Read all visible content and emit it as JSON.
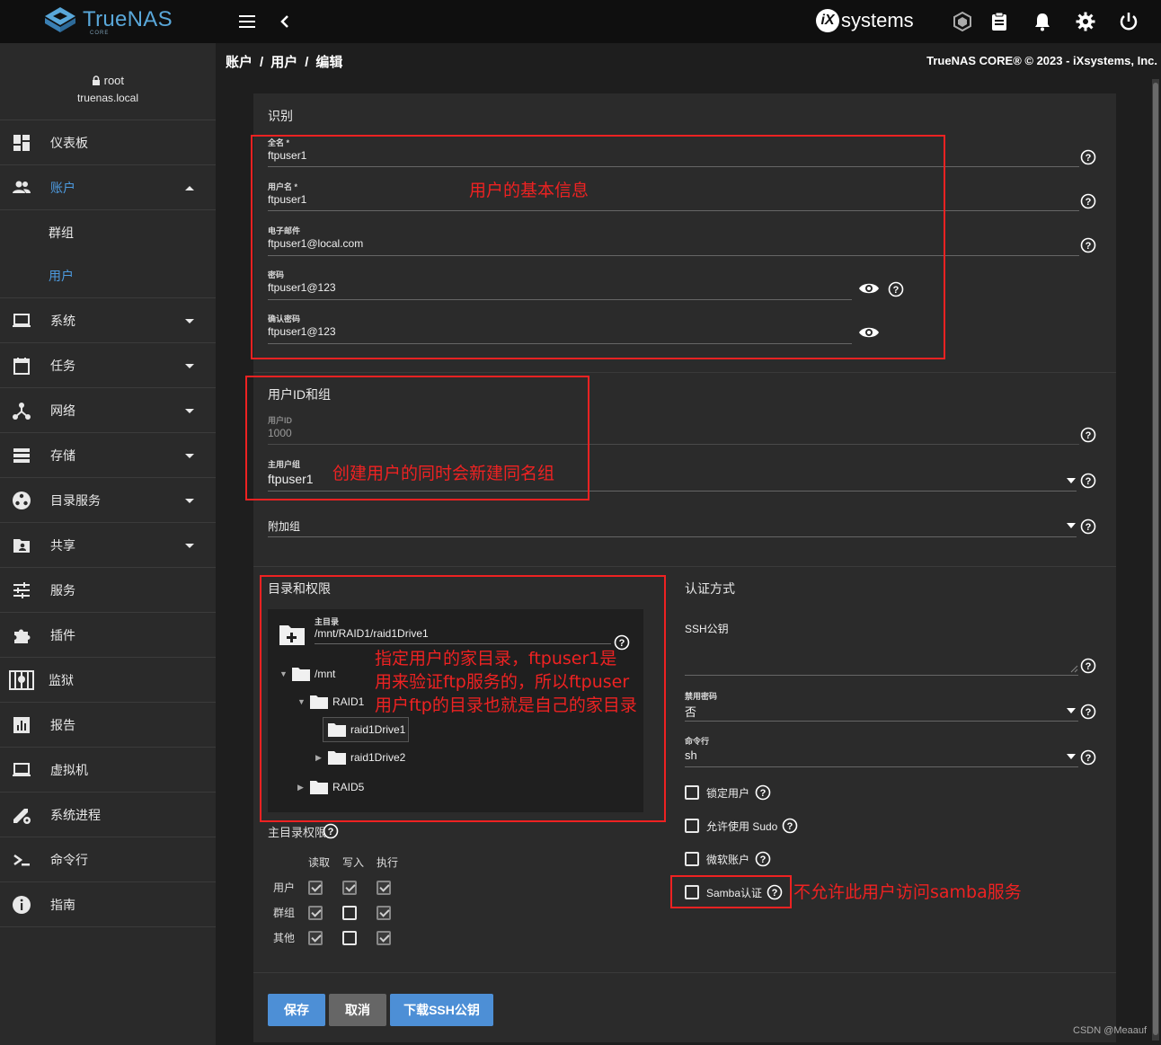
{
  "app": {
    "logo_text": "TrueNAS",
    "logo_sub": "CORE",
    "brand": "systems",
    "brand_ix": "iX"
  },
  "sidebar": {
    "user_name": "root",
    "host": "truenas.local",
    "items": [
      {
        "label": "仪表板",
        "icon": "dashboard-icon"
      },
      {
        "label": "账户",
        "icon": "people-icon",
        "expanded": true
      },
      {
        "label": "群组",
        "icon": ""
      },
      {
        "label": "用户",
        "icon": "",
        "active": true
      },
      {
        "label": "系统",
        "icon": "laptop-icon"
      },
      {
        "label": "任务",
        "icon": "calendar-icon"
      },
      {
        "label": "网络",
        "icon": "network-icon"
      },
      {
        "label": "存储",
        "icon": "storage-icon"
      },
      {
        "label": "目录服务",
        "icon": "directory-icon"
      },
      {
        "label": "共享",
        "icon": "share-folder-icon"
      },
      {
        "label": "服务",
        "icon": "tune-icon"
      },
      {
        "label": "插件",
        "icon": "puzzle-icon"
      },
      {
        "label": "监狱",
        "icon": "jail-icon"
      },
      {
        "label": "报告",
        "icon": "report-icon"
      },
      {
        "label": "虚拟机",
        "icon": "computer-icon"
      },
      {
        "label": "系统进程",
        "icon": "process-icon"
      },
      {
        "label": "命令行",
        "icon": "shell-icon"
      },
      {
        "label": "指南",
        "icon": "info-icon"
      }
    ]
  },
  "breadcrumb": [
    "账户",
    "用户",
    "编辑"
  ],
  "copyright": "TrueNAS CORE® © 2023 - iXsystems, Inc.",
  "identification": {
    "title": "识别",
    "full_name_label": "全名 *",
    "full_name": "ftpuser1",
    "username_label": "用户名 *",
    "username": "ftpuser1",
    "email_label": "电子邮件",
    "email": "ftpuser1@local.com",
    "password_label": "密码",
    "password": "ftpuser1@123",
    "confirm_label": "确认密码",
    "confirm": "ftpuser1@123"
  },
  "ids": {
    "title": "用户ID和组",
    "uid_label": "用户ID",
    "uid": "1000",
    "primary_group_label": "主用户组",
    "primary_group": "ftpuser1",
    "aux_groups_label": "附加组"
  },
  "directories": {
    "title": "目录和权限",
    "home_label": "主目录",
    "home": "/mnt/RAID1/raid1Drive1",
    "tree": [
      "/mnt",
      "RAID1",
      "raid1Drive1",
      "raid1Drive2",
      "RAID5"
    ],
    "perm_label": "主目录权限",
    "perm_cols": [
      "读取",
      "写入",
      "执行"
    ],
    "perm_rows": [
      {
        "label": "用户",
        "values": [
          true,
          true,
          true
        ]
      },
      {
        "label": "群组",
        "values": [
          true,
          false,
          true
        ]
      },
      {
        "label": "其他",
        "values": [
          true,
          false,
          true
        ]
      }
    ]
  },
  "auth": {
    "title": "认证方式",
    "ssh_label": "SSH公钥",
    "disable_pw_label": "禁用密码",
    "disable_pw": "否",
    "shell_label": "命令行",
    "shell": "sh",
    "options": [
      "锁定用户",
      "允许使用 Sudo",
      "微软账户",
      "Samba认证"
    ]
  },
  "buttons": {
    "save": "保存",
    "cancel": "取消",
    "download_ssh": "下载SSH公钥"
  },
  "annotations": {
    "basic_info": "用户的基本信息",
    "same_group": "创建用户的同时会新建同名组",
    "home_note": [
      "指定用户的家目录，ftpuser1是",
      "用来验证ftp服务的，所以ftpuser",
      "用户ftp的目录也就是自己的家目录"
    ],
    "samba_note": "不允许此用户访问samba服务"
  },
  "watermark": "CSDN @Meaauf"
}
